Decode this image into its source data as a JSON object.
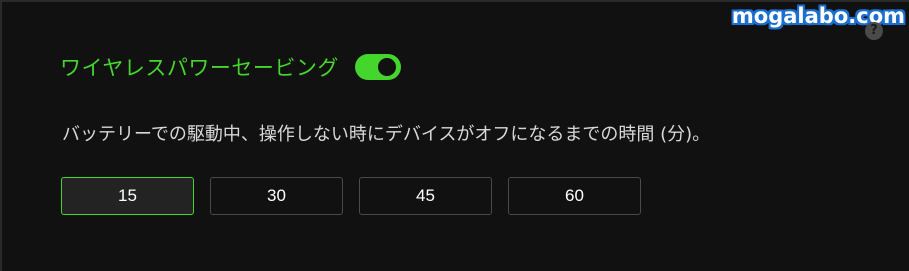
{
  "watermark": "mogalabo.com",
  "help_icon": {
    "glyph": "?",
    "icon": "question-icon"
  },
  "setting": {
    "title": "ワイヤレスパワーセービング",
    "toggle_on": true,
    "description": "バッテリーでの駆動中、操作しない時にデバイスがオフになるまでの時間 (分)。"
  },
  "options": [
    {
      "label": "15",
      "selected": true
    },
    {
      "label": "30",
      "selected": false
    },
    {
      "label": "45",
      "selected": false
    },
    {
      "label": "60",
      "selected": false
    }
  ],
  "colors": {
    "accent": "#44d62c",
    "background": "#111111",
    "text": "#d8d8d8"
  }
}
